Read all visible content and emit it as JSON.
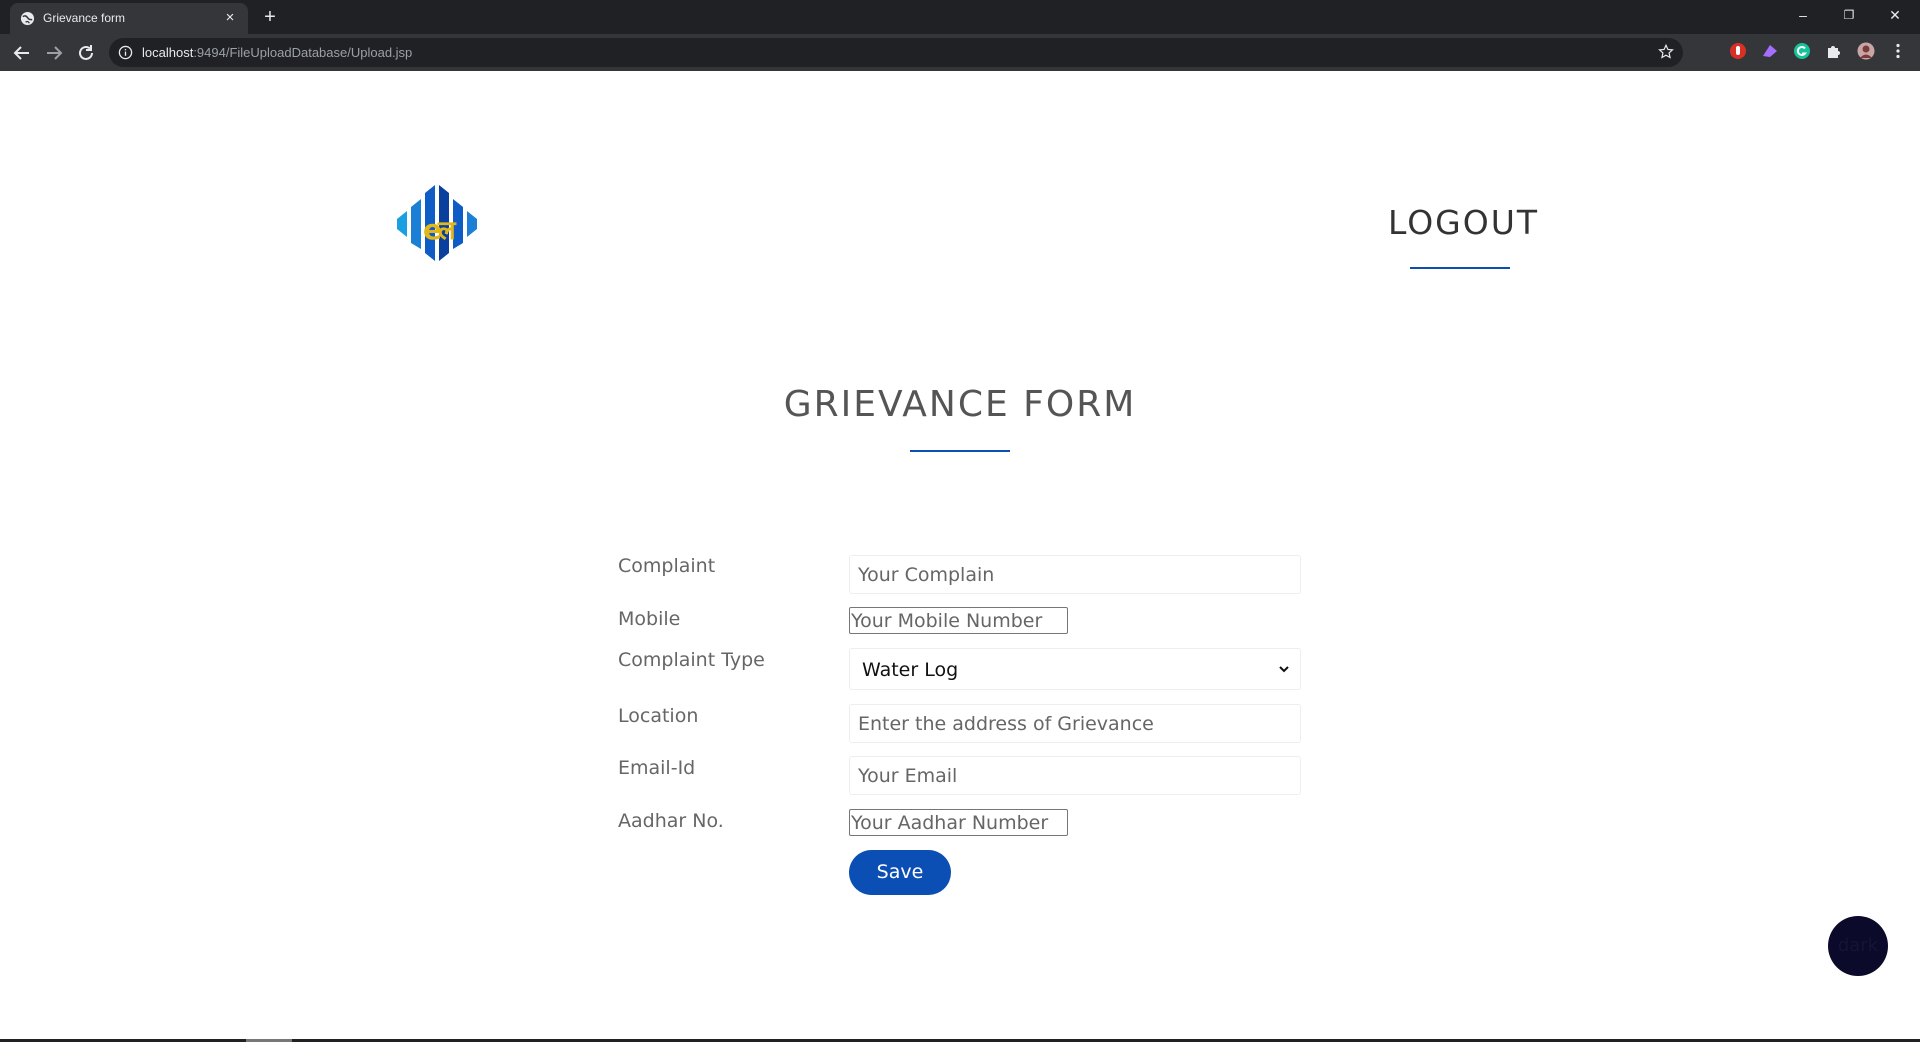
{
  "browser": {
    "tab_title": "Grievance form",
    "tab_close_glyph": "×",
    "new_tab_glyph": "+",
    "url_host": "localhost",
    "url_rest": ":9494/FileUploadDatabase/Upload.jsp",
    "window_controls": [
      "–",
      "❐",
      "✕"
    ]
  },
  "header": {
    "logo_text": "ल",
    "logout_label": "LOGOUT"
  },
  "form": {
    "title": "GRIEVANCE FORM",
    "fields": {
      "complaint_label": "Complaint",
      "complaint_placeholder": "Your Complain",
      "mobile_label": "Mobile",
      "mobile_placeholder": "Your Mobile Number",
      "complaint_type_label": "Complaint Type",
      "complaint_type_value": "Water Log",
      "location_label": "Location",
      "location_placeholder": "Enter the address of Grievance",
      "email_label": "Email-Id",
      "email_placeholder": "Your Email",
      "aadhar_label": "Aadhar No.",
      "aadhar_placeholder": "Your Aadhar Number"
    },
    "save_label": "Save"
  },
  "dark_toggle_label": "dark",
  "colors": {
    "accent": "#0b4fb5",
    "chrome_dark": "#202124",
    "chrome_mid": "#35363a",
    "dark_button": "#0b0a2a"
  }
}
